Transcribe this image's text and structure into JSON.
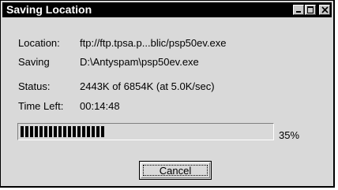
{
  "window": {
    "title": "Saving Location"
  },
  "fields": [
    {
      "label": "Location:",
      "value": "ftp://ftp.tpsa.p...blic/psp50ev.exe"
    },
    {
      "label": "Saving",
      "value": "D:\\Antyspam\\psp50ev.exe"
    },
    {
      "label": "Status:",
      "value": "2443K of 6854K (at 5.0K/sec)"
    },
    {
      "label": "Time Left:",
      "value": "00:14:48"
    }
  ],
  "progress": {
    "percent": 35,
    "label": "35%"
  },
  "buttons": {
    "cancel_label": "Cancel"
  }
}
